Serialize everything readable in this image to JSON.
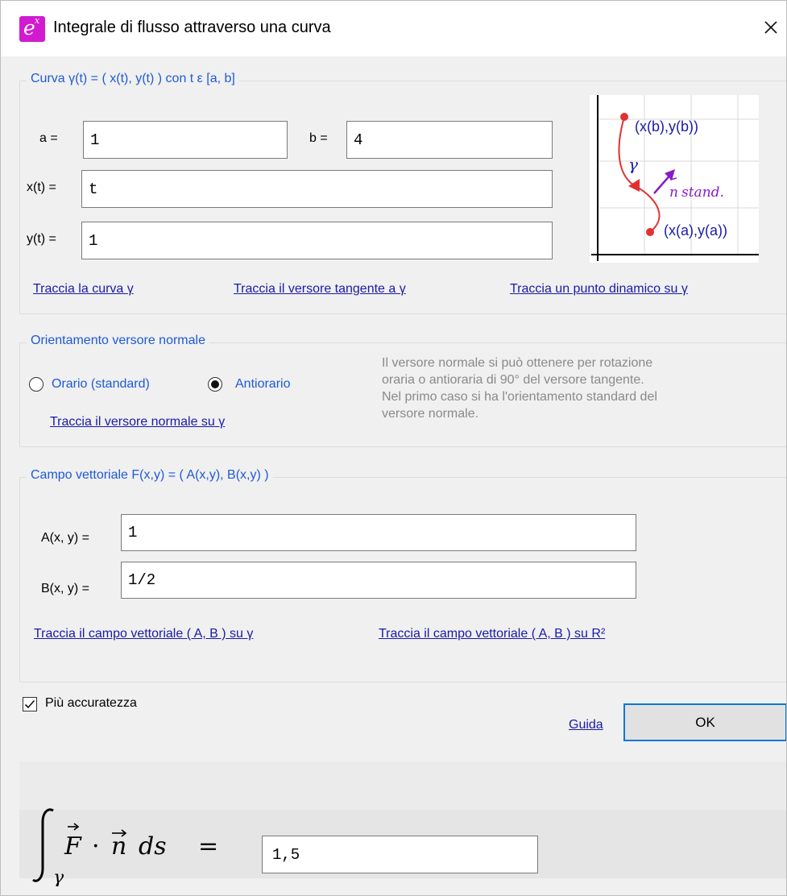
{
  "window": {
    "title": "Integrale di flusso attraverso una curva",
    "icon": "app-icon-ex",
    "close_label": "×"
  },
  "curve": {
    "legend": "Curva γ(t) = ( x(t),  y(t) ) con t ε [a, b]",
    "a_label": "a =",
    "a_value": "1",
    "b_label": "b =",
    "b_value": "4",
    "x_label": "x(t) =",
    "x_value": "t",
    "y_label": "y(t) =",
    "y_value": "1",
    "links": [
      "Traccia la curva γ",
      "Traccia il versore tangente a γ",
      "Traccia un punto dinamico su γ"
    ],
    "illustration": {
      "label_b": "(x(b),y(b))",
      "label_a": "(x(a),y(a))",
      "gamma": "γ",
      "normal_label": "stand.",
      "normal_vec": "n"
    }
  },
  "orientation": {
    "legend": "Orientamento versore normale",
    "option_clockwise": "Orario (standard)",
    "option_counter": "Antiorario",
    "selected": "Antiorario",
    "link": "Traccia il versore normale su γ",
    "info_lines": [
      "Il versore normale si può ottenere per rotazione",
      "oraria o antioraria di  90° del versore tangente.",
      "Nel primo caso si ha l'orientamento standard del",
      "versore normale."
    ]
  },
  "field": {
    "legend": "Campo vettoriale F(x,y) = ( A(x,y), B(x,y) )",
    "A_label": "A(x, y) =",
    "A_value": "1",
    "B_label": "B(x, y) =",
    "B_value": "1/2",
    "link_curve": "Traccia il campo vettoriale ( A, B ) su γ",
    "link_plane": "Traccia il campo vettoriale ( A, B ) su R²"
  },
  "options": {
    "accuracy_label": "Più accuratezza",
    "accuracy_checked": true
  },
  "buttons": {
    "help": "Guida",
    "ok": "OK"
  },
  "result": {
    "equals": "=",
    "value": "1,5",
    "gamma": "γ",
    "ds": "ds"
  },
  "colors": {
    "accent": "#1e5ad6",
    "link": "#1a1aa8",
    "magenta": "#d11bd0",
    "red": "#e23030",
    "purple": "#8a1ac8"
  }
}
